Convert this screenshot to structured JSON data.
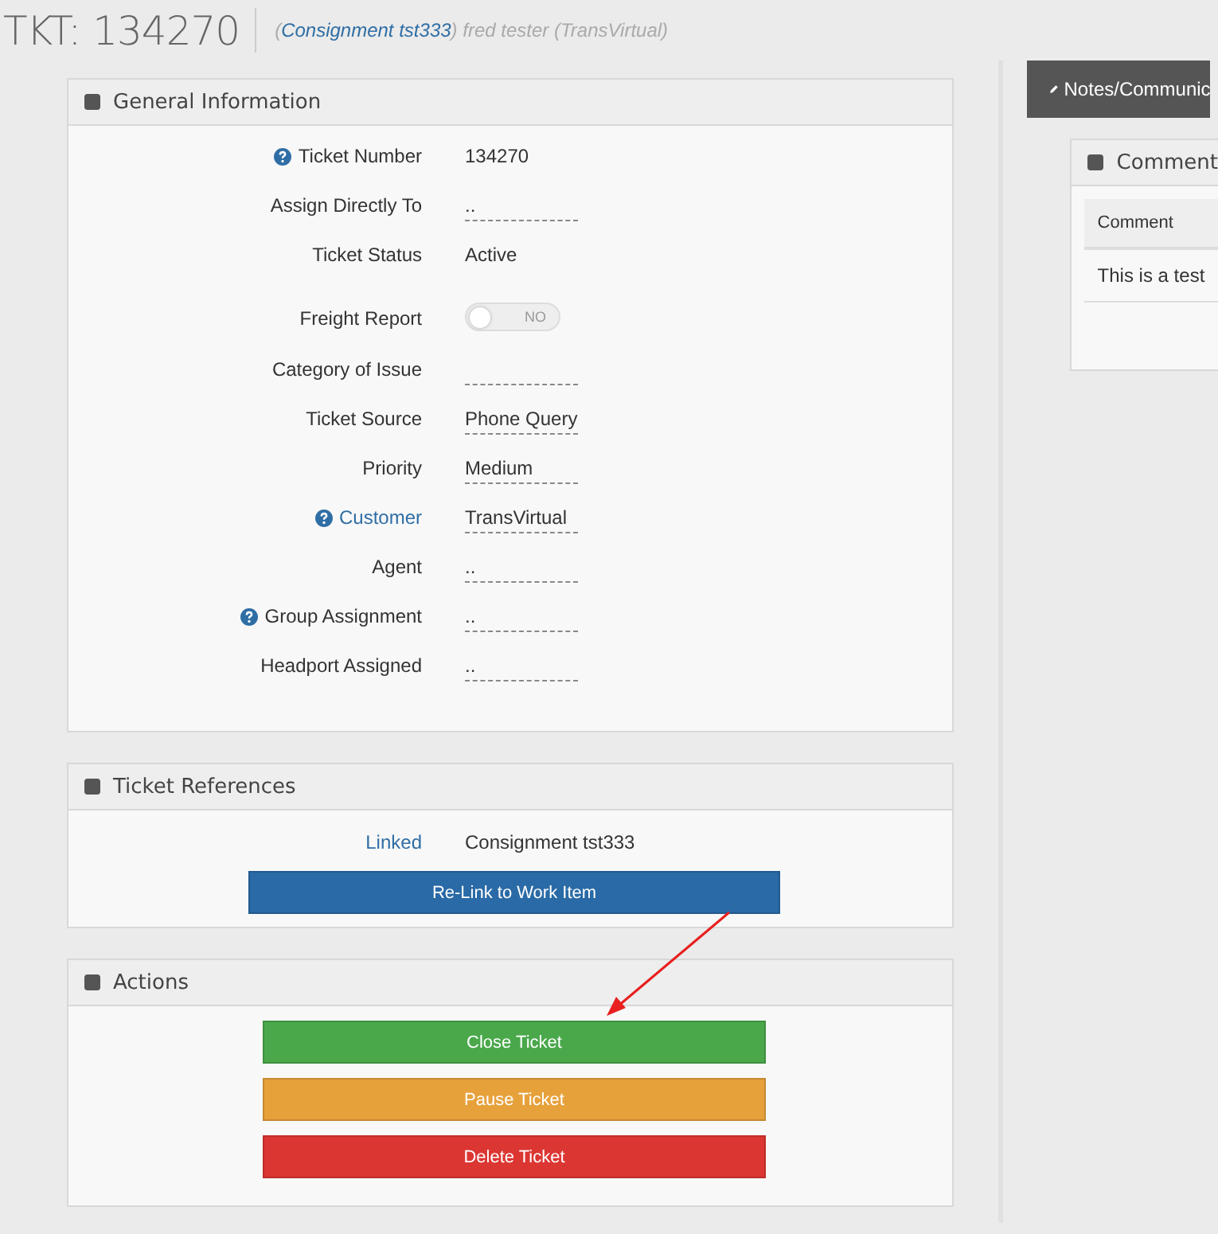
{
  "header": {
    "title": "TKT: 134270",
    "subtitle_open": "(",
    "subtitle_link": "Consignment tst333",
    "subtitle_rest": ") fred tester (TransVirtual)"
  },
  "general": {
    "title": "General Information",
    "fields": [
      {
        "label": "Ticket Number",
        "help": true,
        "link": false,
        "kind": "text",
        "value": "134270"
      },
      {
        "label": "Assign Directly To",
        "help": false,
        "link": false,
        "kind": "editable",
        "value": ".."
      },
      {
        "label": "Ticket Status",
        "help": false,
        "link": false,
        "kind": "text",
        "value": "Active"
      },
      {
        "label": "Freight Report",
        "help": false,
        "link": false,
        "kind": "toggle",
        "on": false,
        "value": "NO"
      },
      {
        "label": "Category of Issue",
        "help": false,
        "link": false,
        "kind": "editable"
      },
      {
        "label": "Ticket Source",
        "help": false,
        "link": false,
        "kind": "editable",
        "value": "Phone Query"
      },
      {
        "label": "Priority",
        "help": false,
        "link": false,
        "kind": "editable",
        "value": "Medium"
      },
      {
        "label": "Customer",
        "help": true,
        "link": true,
        "kind": "editable",
        "value": "TransVirtual"
      },
      {
        "label": "Agent",
        "help": false,
        "link": false,
        "kind": "editable",
        "value": ".."
      },
      {
        "label": "Group Assignment",
        "help": true,
        "link": false,
        "kind": "editable",
        "value": ".."
      },
      {
        "label": "Headport Assigned",
        "help": false,
        "link": false,
        "kind": "editable",
        "value": ".."
      }
    ]
  },
  "references": {
    "title": "Ticket References",
    "label": "Linked",
    "value": "Consignment tst333",
    "button": "Re-Link to Work Item"
  },
  "actions": {
    "title": "Actions",
    "buttons": [
      {
        "label": "Close Ticket",
        "kind": "success"
      },
      {
        "label": "Pause Ticket",
        "kind": "warning"
      },
      {
        "label": "Delete Ticket",
        "kind": "danger"
      }
    ]
  },
  "side": {
    "tab": "Notes/Communic",
    "panel_title": "Comment",
    "columns": [
      "Comment"
    ],
    "rows": [
      [
        "This is a test"
      ]
    ]
  }
}
